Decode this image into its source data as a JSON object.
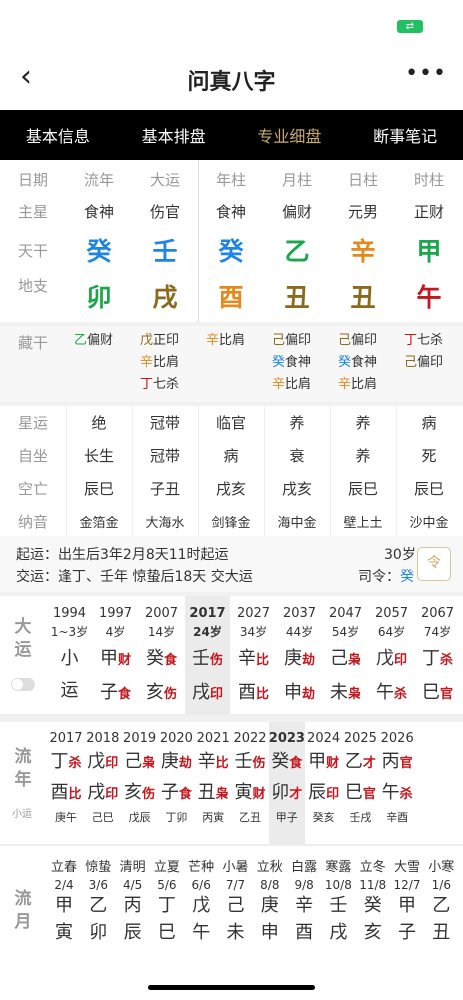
{
  "status": {
    "battery_icon": "battery-charging-icon"
  },
  "nav": {
    "back": "‹",
    "title": "问真八字",
    "more": "•••"
  },
  "tabs": [
    "基本信息",
    "基本排盘",
    "专业细盘",
    "断事笔记"
  ],
  "pillars": {
    "headers": [
      "日期",
      "流年",
      "大运",
      "年柱",
      "月柱",
      "日柱",
      "时柱"
    ],
    "main_star_label": "主星",
    "main_stars": [
      "食神",
      "伤官",
      "食神",
      "偏财",
      "元男",
      "正财"
    ],
    "tiangan_label": "天干",
    "tiangan": [
      "癸",
      "壬",
      "癸",
      "乙",
      "辛",
      "甲"
    ],
    "dizhi_label": "地支",
    "dizhi": [
      "卯",
      "戌",
      "酉",
      "丑",
      "丑",
      "午"
    ]
  },
  "canggan": {
    "label": "藏干",
    "cols": [
      [
        {
          "c": "乙",
          "t": "偏财"
        }
      ],
      [
        {
          "c": "戊",
          "t": "正印"
        },
        {
          "c": "辛",
          "t": "比肩"
        },
        {
          "c": "丁",
          "t": "七杀"
        }
      ],
      [
        {
          "c": "辛",
          "t": "比肩"
        }
      ],
      [
        {
          "c": "己",
          "t": "偏印"
        },
        {
          "c": "癸",
          "t": "食神"
        },
        {
          "c": "辛",
          "t": "比肩"
        }
      ],
      [
        {
          "c": "己",
          "t": "偏印"
        },
        {
          "c": "癸",
          "t": "食神"
        },
        {
          "c": "辛",
          "t": "比肩"
        }
      ],
      [
        {
          "c": "丁",
          "t": "七杀"
        },
        {
          "c": "己",
          "t": "偏印"
        }
      ]
    ]
  },
  "misc": {
    "rows": [
      {
        "label": "星运",
        "vals": [
          "绝",
          "冠带",
          "临官",
          "养",
          "养",
          "病"
        ]
      },
      {
        "label": "自坐",
        "vals": [
          "长生",
          "冠带",
          "病",
          "衰",
          "养",
          "死"
        ]
      },
      {
        "label": "空亡",
        "vals": [
          "辰巳",
          "子丑",
          "戌亥",
          "戌亥",
          "辰巳",
          "辰巳"
        ]
      },
      {
        "label": "纳音",
        "vals": [
          "金箔金",
          "大海水",
          "剑锋金",
          "海中金",
          "壁上土",
          "沙中金"
        ]
      }
    ]
  },
  "luck": {
    "qiyun": "起运：出生后3年2月8天11时起运",
    "jiaoyun": "交运：逢丁、壬年 惊蛰后18天 交大运",
    "age": "30岁",
    "siling_label": "司令：",
    "siling_value": "癸",
    "ling_button": "令"
  },
  "dayun": {
    "label": [
      "大",
      "运"
    ],
    "items": [
      {
        "year": "1994",
        "age": "1~3岁",
        "top": "小",
        "top_shen": "",
        "bot": "运",
        "bot_shen": ""
      },
      {
        "year": "1997",
        "age": "4岁",
        "top": "甲",
        "top_shen": "财",
        "bot": "子",
        "bot_shen": "食"
      },
      {
        "year": "2007",
        "age": "14岁",
        "top": "癸",
        "top_shen": "食",
        "bot": "亥",
        "bot_shen": "伤"
      },
      {
        "year": "2017",
        "age": "24岁",
        "top": "壬",
        "top_shen": "伤",
        "bot": "戌",
        "bot_shen": "印"
      },
      {
        "year": "2027",
        "age": "34岁",
        "top": "辛",
        "top_shen": "比",
        "bot": "酉",
        "bot_shen": "比"
      },
      {
        "year": "2037",
        "age": "44岁",
        "top": "庚",
        "top_shen": "劫",
        "bot": "申",
        "bot_shen": "劫"
      },
      {
        "year": "2047",
        "age": "54岁",
        "top": "己",
        "top_shen": "枭",
        "bot": "未",
        "bot_shen": "枭"
      },
      {
        "year": "2057",
        "age": "64岁",
        "top": "戊",
        "top_shen": "印",
        "bot": "午",
        "bot_shen": "杀"
      },
      {
        "year": "2067",
        "age": "74岁",
        "top": "丁",
        "top_shen": "杀",
        "bot": "巳",
        "bot_shen": "官"
      }
    ]
  },
  "liunian": {
    "label": [
      "流",
      "年"
    ],
    "sub": "小运",
    "items": [
      {
        "year": "2017",
        "top": "丁",
        "top_shen": "杀",
        "bot": "酉",
        "bot_shen": "比",
        "xy": "庚午"
      },
      {
        "year": "2018",
        "top": "戊",
        "top_shen": "印",
        "bot": "戌",
        "bot_shen": "印",
        "xy": "己巳"
      },
      {
        "year": "2019",
        "top": "己",
        "top_shen": "枭",
        "bot": "亥",
        "bot_shen": "伤",
        "xy": "戊辰"
      },
      {
        "year": "2020",
        "top": "庚",
        "top_shen": "劫",
        "bot": "子",
        "bot_shen": "食",
        "xy": "丁卯"
      },
      {
        "year": "2021",
        "top": "辛",
        "top_shen": "比",
        "bot": "丑",
        "bot_shen": "枭",
        "xy": "丙寅"
      },
      {
        "year": "2022",
        "top": "壬",
        "top_shen": "伤",
        "bot": "寅",
        "bot_shen": "财",
        "xy": "乙丑"
      },
      {
        "year": "2023",
        "top": "癸",
        "top_shen": "食",
        "bot": "卯",
        "bot_shen": "才",
        "xy": "甲子"
      },
      {
        "year": "2024",
        "top": "甲",
        "top_shen": "财",
        "bot": "辰",
        "bot_shen": "印",
        "xy": "癸亥"
      },
      {
        "year": "2025",
        "top": "乙",
        "top_shen": "才",
        "bot": "巳",
        "bot_shen": "官",
        "xy": "壬戌"
      },
      {
        "year": "2026",
        "top": "丙",
        "top_shen": "官",
        "bot": "午",
        "bot_shen": "杀",
        "xy": "辛酉"
      }
    ]
  },
  "liuyue": {
    "label": [
      "流",
      "月"
    ],
    "items": [
      {
        "term": "立春",
        "date": "2/4",
        "a": "甲",
        "b": "寅"
      },
      {
        "term": "惊蛰",
        "date": "3/6",
        "a": "乙",
        "b": "卯"
      },
      {
        "term": "清明",
        "date": "4/5",
        "a": "丙",
        "b": "辰"
      },
      {
        "term": "立夏",
        "date": "5/6",
        "a": "丁",
        "b": "巳"
      },
      {
        "term": "芒种",
        "date": "6/6",
        "a": "戊",
        "b": "午"
      },
      {
        "term": "小暑",
        "date": "7/7",
        "a": "己",
        "b": "未"
      },
      {
        "term": "立秋",
        "date": "8/8",
        "a": "庚",
        "b": "申"
      },
      {
        "term": "白露",
        "date": "9/8",
        "a": "辛",
        "b": "酉"
      },
      {
        "term": "寒露",
        "date": "10/8",
        "a": "壬",
        "b": "戌"
      },
      {
        "term": "立冬",
        "date": "11/8",
        "a": "癸",
        "b": "亥"
      },
      {
        "term": "大雪",
        "date": "12/7",
        "a": "甲",
        "b": "子"
      },
      {
        "term": "小寒",
        "date": "1/6",
        "a": "乙",
        "b": "丑"
      }
    ]
  },
  "colors": {
    "wood": "#1aa64a",
    "fire": "#c4161c",
    "earth": "#8c6a1c",
    "metal": "#e5891b",
    "water": "#1d85e6",
    "shen_red": "#c4161c",
    "active_tab": "#c9a86a"
  }
}
